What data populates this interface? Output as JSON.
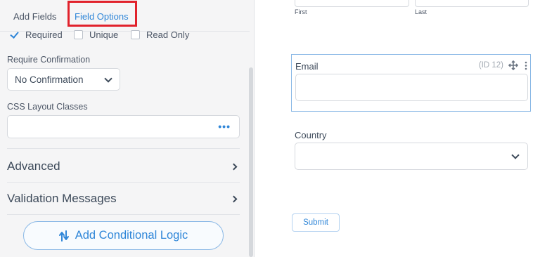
{
  "tabs": {
    "add_fields": "Add Fields",
    "field_options": "Field Options"
  },
  "checkboxes": [
    {
      "label": "Required",
      "checked": true
    },
    {
      "label": "Unique",
      "checked": false
    },
    {
      "label": "Read Only",
      "checked": false
    }
  ],
  "require_confirmation": {
    "label": "Require Confirmation",
    "value": "No Confirmation"
  },
  "css_layout": {
    "label": "CSS Layout Classes",
    "value": "",
    "more_icon": "•••"
  },
  "sections": {
    "advanced": "Advanced",
    "validation": "Validation Messages"
  },
  "conditional_button": "Add Conditional Logic",
  "preview": {
    "first_label": "First",
    "last_label": "Last",
    "email_label": "Email",
    "email_id": "(ID 12)",
    "country_label": "Country",
    "submit_label": "Submit"
  },
  "colors": {
    "accent": "#2f86d8",
    "highlight": "#e1222c"
  },
  "icons": [
    "checkmark-icon",
    "chevron-down-icon",
    "more-dots-icon",
    "chevron-right-icon",
    "conditional-logic-icon",
    "move-icon",
    "kebab-menu-icon"
  ]
}
